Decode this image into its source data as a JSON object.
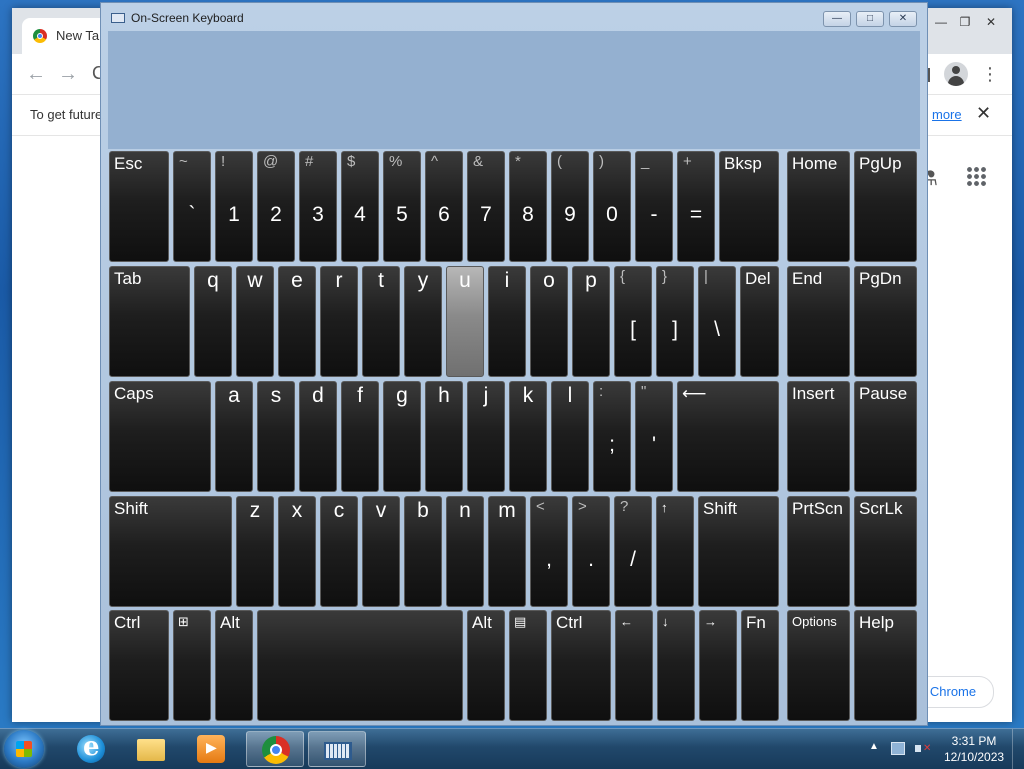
{
  "desktop": {
    "chrome": {
      "tab_title": "New Tab",
      "infobar_text": "To get future",
      "infobar_link": "more",
      "infobar_close": "✕",
      "chrome_button_text": "Chrome",
      "nav_back": "←",
      "nav_forward": "→",
      "omnibox_partial": "C",
      "menu_icon_glyph": "⋮",
      "labs_icon_glyph": "⚗",
      "caption_min": "—",
      "caption_max": "❐",
      "caption_close": "✕"
    },
    "osk": {
      "title": "On-Screen Keyboard",
      "caption_buttons": [
        "—",
        "□",
        "✕"
      ],
      "active_key": "u",
      "rows": [
        [
          {
            "type": "label",
            "label": "Esc"
          },
          {
            "type": "dual",
            "shift": "~",
            "base": "`"
          },
          {
            "type": "dual",
            "shift": "!",
            "base": "1"
          },
          {
            "type": "dual",
            "shift": "@",
            "base": "2"
          },
          {
            "type": "dual",
            "shift": "#",
            "base": "3"
          },
          {
            "type": "dual",
            "shift": "$",
            "base": "4"
          },
          {
            "type": "dual",
            "shift": "%",
            "base": "5"
          },
          {
            "type": "dual",
            "shift": "^",
            "base": "6"
          },
          {
            "type": "dual",
            "shift": "&",
            "base": "7"
          },
          {
            "type": "dual",
            "shift": "*",
            "base": "8"
          },
          {
            "type": "dual",
            "shift": "(",
            "base": "9"
          },
          {
            "type": "dual",
            "shift": ")",
            "base": "0"
          },
          {
            "type": "dual",
            "shift": "_",
            "base": "-"
          },
          {
            "type": "dual",
            "shift": "+",
            "base": "="
          },
          {
            "type": "label",
            "label": "Bksp"
          },
          {
            "type": "label",
            "label": "Home"
          },
          {
            "type": "label",
            "label": "PgUp"
          }
        ],
        [
          {
            "type": "label",
            "label": "Tab"
          },
          {
            "type": "letter",
            "label": "q"
          },
          {
            "type": "letter",
            "label": "w"
          },
          {
            "type": "letter",
            "label": "e"
          },
          {
            "type": "letter",
            "label": "r"
          },
          {
            "type": "letter",
            "label": "t"
          },
          {
            "type": "letter",
            "label": "y"
          },
          {
            "type": "letter",
            "label": "u"
          },
          {
            "type": "letter",
            "label": "i"
          },
          {
            "type": "letter",
            "label": "o"
          },
          {
            "type": "letter",
            "label": "p"
          },
          {
            "type": "dual",
            "shift": "{",
            "base": "["
          },
          {
            "type": "dual",
            "shift": "}",
            "base": "]"
          },
          {
            "type": "dual",
            "shift": "|",
            "base": "\\"
          },
          {
            "type": "label",
            "label": "Del"
          },
          {
            "type": "label",
            "label": "End"
          },
          {
            "type": "label",
            "label": "PgDn"
          }
        ],
        [
          {
            "type": "label",
            "label": "Caps"
          },
          {
            "type": "letter",
            "label": "a"
          },
          {
            "type": "letter",
            "label": "s"
          },
          {
            "type": "letter",
            "label": "d"
          },
          {
            "type": "letter",
            "label": "f"
          },
          {
            "type": "letter",
            "label": "g"
          },
          {
            "type": "letter",
            "label": "h"
          },
          {
            "type": "letter",
            "label": "j"
          },
          {
            "type": "letter",
            "label": "k"
          },
          {
            "type": "letter",
            "label": "l"
          },
          {
            "type": "dual",
            "shift": ":",
            "base": ";"
          },
          {
            "type": "dual",
            "shift": "\"",
            "base": "'"
          },
          {
            "type": "label",
            "label": "⟵"
          },
          {
            "type": "label",
            "label": "Insert"
          },
          {
            "type": "label",
            "label": "Pause"
          }
        ],
        [
          {
            "type": "label",
            "label": "Shift"
          },
          {
            "type": "letter",
            "label": "z"
          },
          {
            "type": "letter",
            "label": "x"
          },
          {
            "type": "letter",
            "label": "c"
          },
          {
            "type": "letter",
            "label": "v"
          },
          {
            "type": "letter",
            "label": "b"
          },
          {
            "type": "letter",
            "label": "n"
          },
          {
            "type": "letter",
            "label": "m"
          },
          {
            "type": "dual",
            "shift": "<",
            "base": ","
          },
          {
            "type": "dual",
            "shift": ">",
            "base": "."
          },
          {
            "type": "dual",
            "shift": "?",
            "base": "/"
          },
          {
            "type": "small",
            "label": "↑"
          },
          {
            "type": "label",
            "label": "Shift"
          },
          {
            "type": "label",
            "label": "PrtScn"
          },
          {
            "type": "label",
            "label": "ScrLk"
          }
        ],
        [
          {
            "type": "label",
            "label": "Ctrl"
          },
          {
            "type": "small",
            "label": "⊞"
          },
          {
            "type": "label",
            "label": "Alt"
          },
          {
            "type": "label",
            "label": ""
          },
          {
            "type": "label",
            "label": "Alt"
          },
          {
            "type": "small",
            "label": "▤"
          },
          {
            "type": "label",
            "label": "Ctrl"
          },
          {
            "type": "small",
            "label": "←"
          },
          {
            "type": "small",
            "label": "↓"
          },
          {
            "type": "small",
            "label": "→"
          },
          {
            "type": "label",
            "label": "Fn"
          },
          {
            "type": "small",
            "label": "Options"
          },
          {
            "type": "label",
            "label": "Help"
          }
        ]
      ]
    }
  },
  "taskbar": {
    "clock_time": "3:31 PM",
    "clock_date": "12/10/2023",
    "tray_expand": "▲",
    "items": [
      "Internet Explorer",
      "Windows Explorer",
      "Windows Media Player",
      "Google Chrome",
      "On-Screen Keyboard"
    ],
    "active_item": "On-Screen Keyboard"
  }
}
